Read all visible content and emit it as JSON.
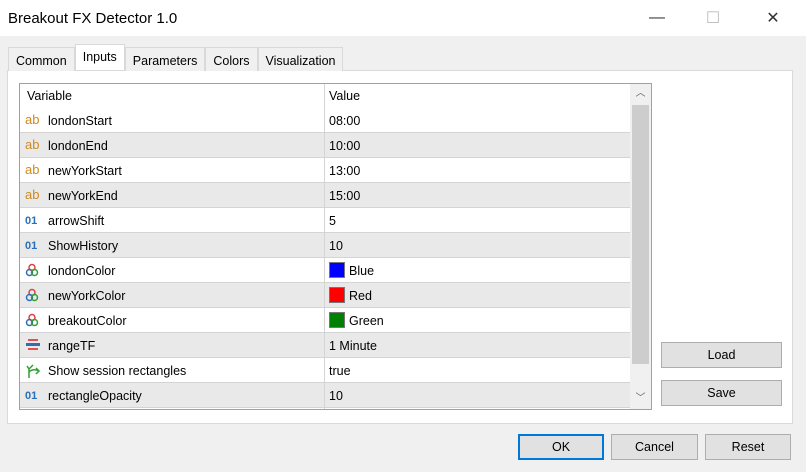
{
  "window": {
    "title": "Breakout FX Detector 1.0",
    "minimize": "—",
    "maximize": "☐",
    "close": "✕"
  },
  "tabs": [
    {
      "label": "Common"
    },
    {
      "label": "Inputs"
    },
    {
      "label": "Parameters"
    },
    {
      "label": "Colors"
    },
    {
      "label": "Visualization"
    }
  ],
  "grid": {
    "col_variable": "Variable",
    "col_value": "Value",
    "rows": [
      {
        "icon": "ab",
        "name": "londonStart",
        "value": "08:00"
      },
      {
        "icon": "ab",
        "name": "londonEnd",
        "value": "10:00"
      },
      {
        "icon": "ab",
        "name": "newYorkStart",
        "value": "13:00"
      },
      {
        "icon": "ab",
        "name": "newYorkEnd",
        "value": "15:00"
      },
      {
        "icon": "01",
        "name": "arrowShift",
        "value": "5"
      },
      {
        "icon": "01",
        "name": "ShowHistory",
        "value": "10"
      },
      {
        "icon": "color",
        "name": "londonColor",
        "value": "Blue",
        "swatch": "#0000ff"
      },
      {
        "icon": "color",
        "name": "newYorkColor",
        "value": "Red",
        "swatch": "#ff0000"
      },
      {
        "icon": "color",
        "name": "breakoutColor",
        "value": "Green",
        "swatch": "#008000"
      },
      {
        "icon": "enum",
        "name": "rangeTF",
        "value": "1 Minute"
      },
      {
        "icon": "bool",
        "name": "Show session rectangles",
        "value": "true"
      },
      {
        "icon": "01",
        "name": "rectangleOpacity",
        "value": "10"
      }
    ]
  },
  "buttons": {
    "load": "Load",
    "save": "Save",
    "ok": "OK",
    "cancel": "Cancel",
    "reset": "Reset"
  }
}
